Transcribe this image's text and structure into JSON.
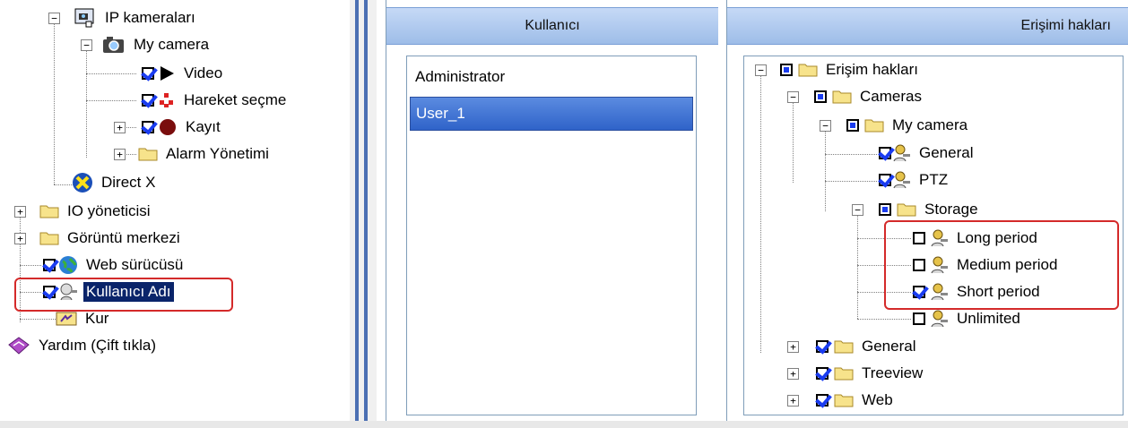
{
  "left_tree": {
    "items": [
      {
        "label": "IP kameraları"
      },
      {
        "label": "My camera"
      },
      {
        "label": "Video"
      },
      {
        "label": "Hareket seçme"
      },
      {
        "label": "Kayıt"
      },
      {
        "label": "Alarm Yönetimi"
      },
      {
        "label": "Direct X"
      },
      {
        "label": "IO yöneticisi"
      },
      {
        "label": "Görüntü merkezi"
      },
      {
        "label": "Web sürücüsü"
      },
      {
        "label": "Kullanıcı Adı"
      },
      {
        "label": "Kur"
      },
      {
        "label": "Yardım (Çift tıkla)"
      }
    ]
  },
  "users_panel": {
    "header": "Kullanıcı",
    "users": [
      "Administrator",
      "User_1"
    ],
    "selected_user": "User_1"
  },
  "rights_panel": {
    "header": "Erişimi hakları",
    "items": [
      {
        "label": "Erişim hakları",
        "state": "partial"
      },
      {
        "label": "Cameras",
        "state": "partial"
      },
      {
        "label": "My camera",
        "state": "partial"
      },
      {
        "label": "General",
        "state": "checked"
      },
      {
        "label": "PTZ",
        "state": "checked"
      },
      {
        "label": "Storage",
        "state": "partial"
      },
      {
        "label": "Long period",
        "state": "unchecked"
      },
      {
        "label": "Medium period",
        "state": "unchecked"
      },
      {
        "label": "Short period",
        "state": "checked"
      },
      {
        "label": "Unlimited",
        "state": "unchecked"
      },
      {
        "label": "General",
        "state": "checked"
      },
      {
        "label": "Treeview",
        "state": "checked"
      },
      {
        "label": "Web",
        "state": "checked"
      }
    ]
  },
  "colors": {
    "highlight_box": "#d42a2a",
    "selection": "#0a246a",
    "header": "#b3cdf0"
  }
}
